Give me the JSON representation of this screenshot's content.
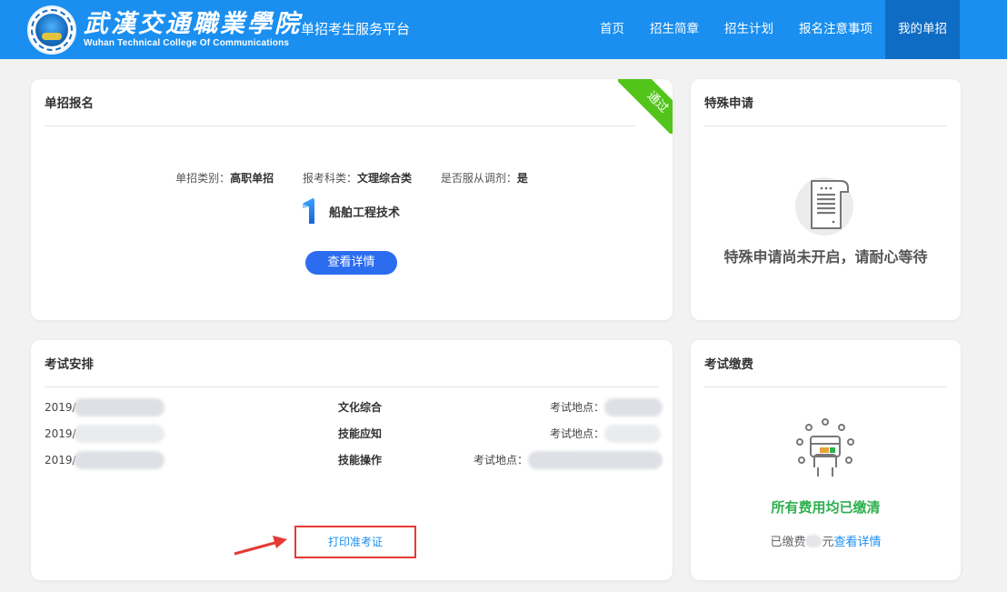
{
  "header": {
    "college_cn": "武漢交通職業學院",
    "college_en": "Wuhan Technical College Of Communications",
    "platform": "单招考生服务平台",
    "nav": [
      {
        "label": "首页",
        "active": false
      },
      {
        "label": "招生简章",
        "active": false
      },
      {
        "label": "招生计划",
        "active": false
      },
      {
        "label": "报名注意事项",
        "active": false
      },
      {
        "label": "我的单招",
        "active": true
      }
    ],
    "colors": {
      "bar": "#1a8ff0",
      "active": "#0f6cc4"
    }
  },
  "signup": {
    "title": "单招报名",
    "ribbon": "通过",
    "info": [
      {
        "label": "单招类别：",
        "value": "高职单招"
      },
      {
        "label": "报考科类：",
        "value": "文理综合类"
      },
      {
        "label": "是否服从调剂：",
        "value": "是"
      }
    ],
    "choice_rank": "1",
    "major": "船舶工程技术",
    "detail_button": "查看详情"
  },
  "special": {
    "title": "特殊申请",
    "icon": "document-scroll-icon",
    "message": "特殊申请尚未开启，请耐心等待"
  },
  "exam": {
    "title": "考试安排",
    "rows": [
      {
        "date": "2019/",
        "subject": "文化综合",
        "location_label": "考试地点："
      },
      {
        "date": "2019/",
        "subject": "技能应知",
        "location_label": "考试地点："
      },
      {
        "date": "2019/",
        "subject": "技能操作",
        "location_label": "考试地点："
      }
    ],
    "print_link": "打印准考证"
  },
  "fee": {
    "title": "考试缴费",
    "icon": "payment-card-hand-icon",
    "status": "所有费用均已缴清",
    "paid_prefix": "已缴费",
    "paid_suffix": "元",
    "detail_link": "查看详情"
  }
}
